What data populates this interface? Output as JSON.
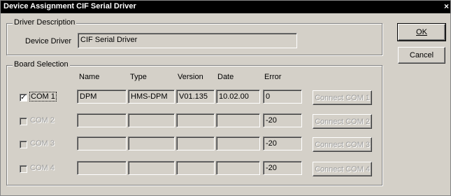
{
  "window": {
    "title": "Device Assignment CIF Serial Driver",
    "close_glyph": "×"
  },
  "driver_description": {
    "group_label": "Driver Description",
    "device_driver_label": "Device Driver",
    "device_driver_value": "CIF Serial Driver"
  },
  "board_selection": {
    "group_label": "Board Selection",
    "columns": {
      "name": "Name",
      "type": "Type",
      "version": "Version",
      "date": "Date",
      "error": "Error"
    },
    "rows": [
      {
        "label": "COM 1",
        "checked": true,
        "enabled": true,
        "checkmark": "✓",
        "name": "DPM",
        "type": "HMS-DPM",
        "version": "V01.135",
        "date": "10.02.00",
        "error": "0",
        "connect_label": "Connect COM 1"
      },
      {
        "label": "COM 2",
        "checked": false,
        "enabled": false,
        "checkmark": "",
        "name": "",
        "type": "",
        "version": "",
        "date": "",
        "error": "-20",
        "connect_label": "Connect COM 2"
      },
      {
        "label": "COM 3",
        "checked": false,
        "enabled": false,
        "checkmark": "",
        "name": "",
        "type": "",
        "version": "",
        "date": "",
        "error": "-20",
        "connect_label": "Connect COM 3"
      },
      {
        "label": "COM 4",
        "checked": false,
        "enabled": false,
        "checkmark": "",
        "name": "",
        "type": "",
        "version": "",
        "date": "",
        "error": "-20",
        "connect_label": "Connect COM 4"
      }
    ]
  },
  "buttons": {
    "ok": "OK",
    "cancel": "Cancel"
  }
}
